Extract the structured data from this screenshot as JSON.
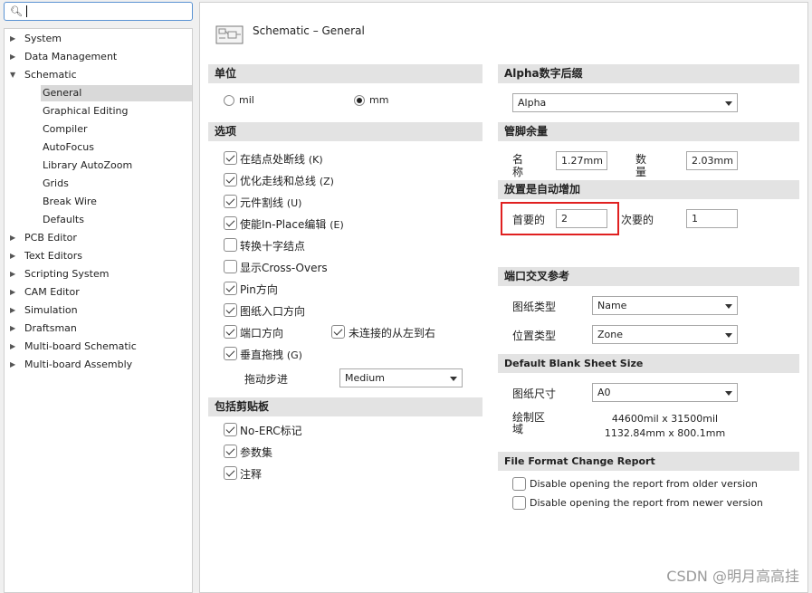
{
  "search": {
    "value": ""
  },
  "tree": [
    {
      "label": "System",
      "expanded": false
    },
    {
      "label": "Data Management",
      "expanded": false
    },
    {
      "label": "Schematic",
      "expanded": true
    },
    {
      "label": "General",
      "child": true,
      "selected": true
    },
    {
      "label": "Graphical Editing",
      "child": true
    },
    {
      "label": "Compiler",
      "child": true
    },
    {
      "label": "AutoFocus",
      "child": true
    },
    {
      "label": "Library AutoZoom",
      "child": true
    },
    {
      "label": "Grids",
      "child": true
    },
    {
      "label": "Break Wire",
      "child": true
    },
    {
      "label": "Defaults",
      "child": true
    },
    {
      "label": "PCB Editor",
      "expanded": false
    },
    {
      "label": "Text Editors",
      "expanded": false
    },
    {
      "label": "Scripting System",
      "expanded": false
    },
    {
      "label": "CAM Editor",
      "expanded": false
    },
    {
      "label": "Simulation",
      "expanded": false
    },
    {
      "label": "Draftsman",
      "expanded": false
    },
    {
      "label": "Multi-board Schematic",
      "expanded": false
    },
    {
      "label": "Multi-board Assembly",
      "expanded": false
    }
  ],
  "page": {
    "title": "Schematic – General"
  },
  "units": {
    "header": "单位",
    "mil": "mil",
    "mm": "mm",
    "selected": "mm"
  },
  "options": {
    "header": "选项",
    "items": [
      {
        "label": "在结点处断线",
        "shortcut": "(K)",
        "checked": true
      },
      {
        "label": "优化走线和总线",
        "shortcut": "(Z)",
        "checked": true
      },
      {
        "label": "元件割线",
        "shortcut": "(U)",
        "checked": true
      },
      {
        "label": "使能In-Place编辑",
        "shortcut": "(E)",
        "checked": true
      },
      {
        "label": "转换十字结点",
        "shortcut": "",
        "checked": false
      },
      {
        "label": "显示Cross-Overs",
        "shortcut": "",
        "checked": false
      },
      {
        "label": "Pin方向",
        "shortcut": "",
        "checked": true
      },
      {
        "label": "图纸入口方向",
        "shortcut": "",
        "checked": true
      },
      {
        "label": "端口方向",
        "shortcut": "",
        "checked": true
      },
      {
        "label": "垂直拖拽",
        "shortcut": "(G)",
        "checked": true
      }
    ],
    "unconnected_left_to_right": {
      "label": "未连接的从左到右",
      "checked": true
    },
    "drag_step": {
      "label": "拖动步进",
      "value": "Medium"
    }
  },
  "clipboard": {
    "header": "包括剪贴板",
    "items": [
      {
        "label": "No-ERC标记",
        "checked": true
      },
      {
        "label": "参数集",
        "checked": true
      },
      {
        "label": "注释",
        "checked": true
      }
    ]
  },
  "alpha_suffix": {
    "header": "Alpha数字后缀",
    "value": "Alpha"
  },
  "pin_margin": {
    "header": "管脚余量",
    "name_label": "名称",
    "name_value": "1.27mm",
    "number_label": "数量",
    "number_value": "2.03mm"
  },
  "auto_increment": {
    "header": "放置是自动增加",
    "primary_label": "首要的",
    "primary_value": "2",
    "secondary_label": "次要的",
    "secondary_value": "1"
  },
  "port_cross_ref": {
    "header": "端口交叉参考",
    "sheet_type_label": "图纸类型",
    "sheet_type_value": "Name",
    "location_type_label": "位置类型",
    "location_type_value": "Zone"
  },
  "blank_sheet": {
    "header": "Default Blank Sheet Size",
    "size_label": "图纸尺寸",
    "size_value": "A0",
    "area_label": "绘制区域",
    "area_mil": "44600mil x 31500mil",
    "area_mm": "1132.84mm x 800.1mm"
  },
  "file_format": {
    "header": "File Format Change Report",
    "older": {
      "label": "Disable opening the report from older version",
      "checked": false
    },
    "newer": {
      "label": "Disable opening the report from newer version",
      "checked": false
    }
  },
  "watermark": "CSDN @明月高高挂",
  "colors": {
    "highlight": "#e02020",
    "accent": "#5b93d3",
    "section_bg": "#e3e3e3"
  }
}
